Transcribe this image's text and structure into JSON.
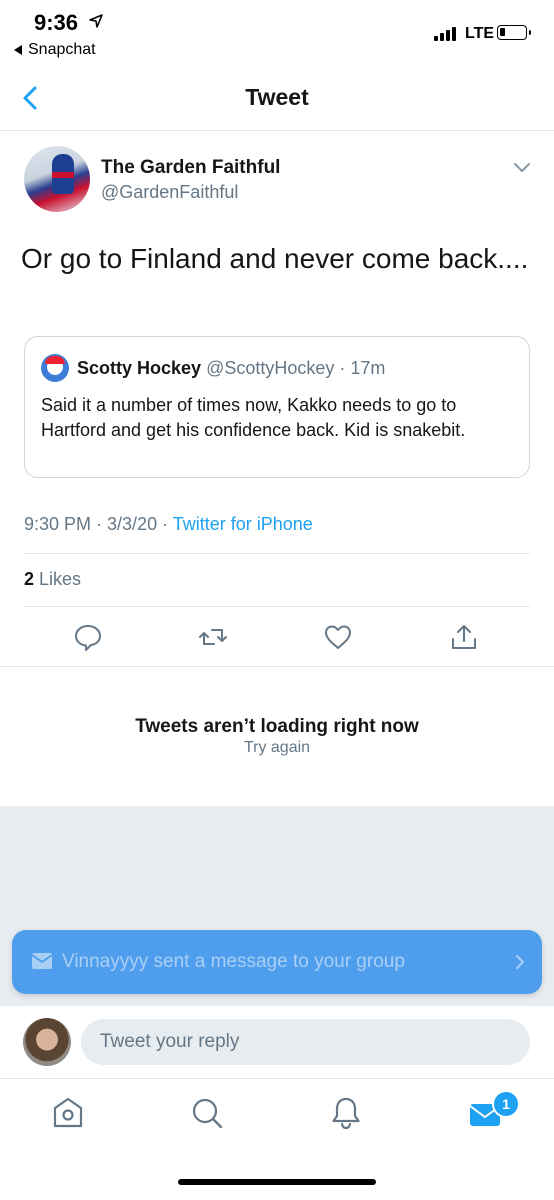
{
  "status_bar": {
    "time": "9:36",
    "back_app": "Snapchat",
    "network": "LTE"
  },
  "nav": {
    "title": "Tweet",
    "back_icon": "chevron-left-icon"
  },
  "tweet": {
    "author_name": "The Garden Faithful",
    "author_handle": "@GardenFaithful",
    "text": "Or go to Finland and never come back....",
    "timestamp": "9:30 PM · 3/3/20 · ",
    "source": "Twitter for iPhone",
    "likes_count": "2",
    "likes_label": " Likes"
  },
  "quoted_tweet": {
    "author_name": "Scotty Hockey",
    "author_handle": "@ScottyHockey",
    "age": " · 17m",
    "text": "Said it a number of times now, Kakko needs to go to Hartford and get his confidence back. Kid is snakebit."
  },
  "actions": [
    "reply-icon",
    "retweet-icon",
    "like-icon",
    "share-icon"
  ],
  "error": {
    "title": "Tweets aren’t loading right now",
    "retry": "Try again"
  },
  "notification_banner": {
    "text": "Vinnayyyy sent a message to your group"
  },
  "reply": {
    "placeholder": "Tweet your reply"
  },
  "tab_bar": {
    "items": [
      "home-icon",
      "search-icon",
      "notifications-icon",
      "messages-icon"
    ],
    "messages_badge": "1"
  },
  "colors": {
    "accent": "#1da1f2",
    "secondary_text": "#657786",
    "banner": "#4f9ded"
  }
}
